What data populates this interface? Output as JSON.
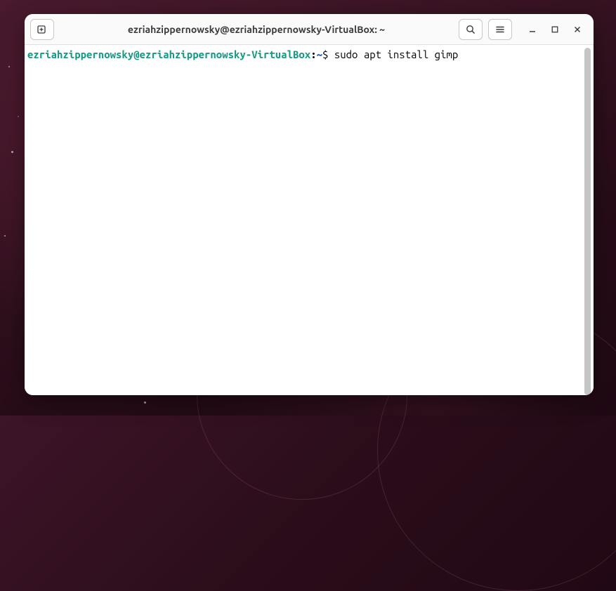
{
  "window": {
    "title": "ezriahzippernowsky@ezriahzippernowsky-VirtualBox: ~"
  },
  "terminal": {
    "prompt": {
      "userhost": "ezriahzippernowsky@ezriahzippernowsky-VirtualBox",
      "colon": ":",
      "path": "~",
      "dollar": "$ ",
      "command": "sudo apt install gimp"
    }
  },
  "colors": {
    "prompt_userhost": "#179a84",
    "prompt_path": "#3060c0",
    "titlebar_bg": "#fafafa"
  }
}
